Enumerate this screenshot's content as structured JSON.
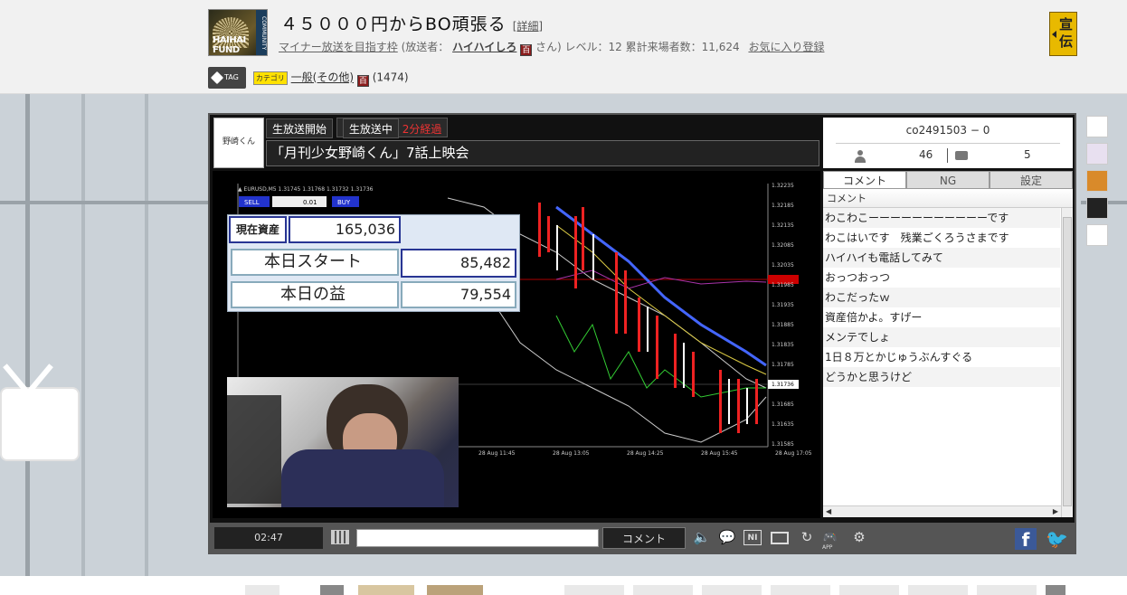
{
  "header": {
    "logo_text": "HAIHAI FUND",
    "logo_side": "COMMUNITY",
    "title": "４５０００円からBO頑張る",
    "detail_link": "[詳細]",
    "community_link": "マイナー放送を目指す枠",
    "broadcaster_prefix": "(放送者：",
    "broadcaster_name": "ハイハイしろ",
    "broadcaster_suffix": "さん) レベル：12 累計来場者数：11,624",
    "favorite_link": "お気に入り登録",
    "ad_label": "宣伝"
  },
  "tags": {
    "tag_label": "TAG",
    "category_label": "カテゴリ",
    "category_link": "一般(その他)",
    "hyaku_mark": "百",
    "count": "(1474)"
  },
  "player": {
    "channel_label": "野崎くん",
    "status_start": "生放送開始",
    "status_live": "生放送中",
    "elapsed": "2分経過",
    "stream_title": "「月刊少女野崎くん」7話上映会",
    "video": {
      "assets_label": "現在資産",
      "assets_value": "165,036",
      "start_label": "本日スタート",
      "start_value": "85,482",
      "profit_label": "本日の益",
      "profit_value": "79,554",
      "symbol_line": "▲ EURUSD,M5 1.31745 1.31768 1.31732 1.31736",
      "sell_label": "SELL",
      "buy_label": "BUY",
      "lot": "0.01",
      "price_ticks": [
        "1.32235",
        "1.32185",
        "1.32135",
        "1.32085",
        "1.32035",
        "1.31985",
        "1.31935",
        "1.31885",
        "1.31835",
        "1.31785",
        "1.31736",
        "1.31685",
        "1.31635",
        "1.31585"
      ],
      "time_ticks": [
        "25",
        "28 Aug 07:45",
        "28 Aug 09:05",
        "28 Aug 10:25",
        "28 Aug 11:45",
        "28 Aug 13:05",
        "28 Aug 14:25",
        "28 Aug 15:45",
        "28 Aug 17:05"
      ]
    },
    "info": {
      "community_id": "co2491503 − 0",
      "viewers": "46",
      "comments": "5"
    },
    "tabs": [
      "コメント",
      "NG",
      "設定"
    ],
    "comment_header": "コメント",
    "comments": [
      "わこわこーーーーーーーーーーーです",
      "わこはいです　残業ごくろうさまです",
      "ハイハイも電話してみて",
      "おっつおっつ",
      "わこだったｗ",
      "資産倍かよ。すげー",
      "メンテでしょ",
      "1日８万とかじゅうぶんすぐる",
      "どうかと思うけど"
    ],
    "controls": {
      "time": "02:47",
      "comment_button": "コメント",
      "app_label": "APP"
    }
  }
}
